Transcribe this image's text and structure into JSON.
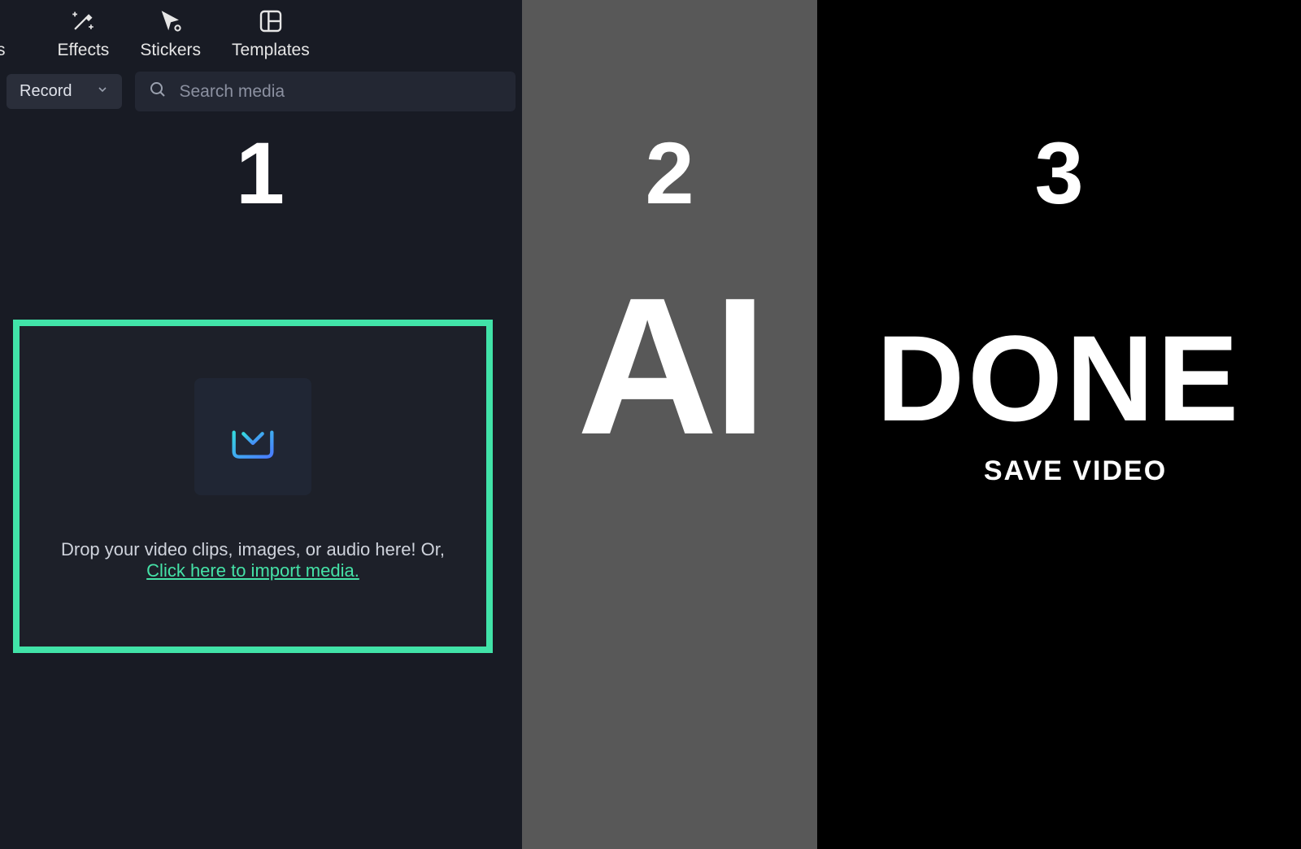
{
  "toolbar": {
    "partial_label": "s",
    "items": [
      {
        "label": "Effects",
        "icon": "wand-sparkles-icon"
      },
      {
        "label": "Stickers",
        "icon": "cursor-sparkle-icon"
      },
      {
        "label": "Templates",
        "icon": "layout-grid-icon"
      }
    ]
  },
  "subbar": {
    "record_label": "Record",
    "search_placeholder": "Search media"
  },
  "panel1": {
    "step": "1",
    "drop_text": "Drop your video clips, images, or audio here! Or,",
    "drop_link": "Click here to import media.",
    "highlight_color": "#41e3a8"
  },
  "panel2": {
    "step": "2",
    "headline": "AI"
  },
  "panel3": {
    "step": "3",
    "headline": "DONE",
    "subhead": "SAVE VIDEO"
  }
}
